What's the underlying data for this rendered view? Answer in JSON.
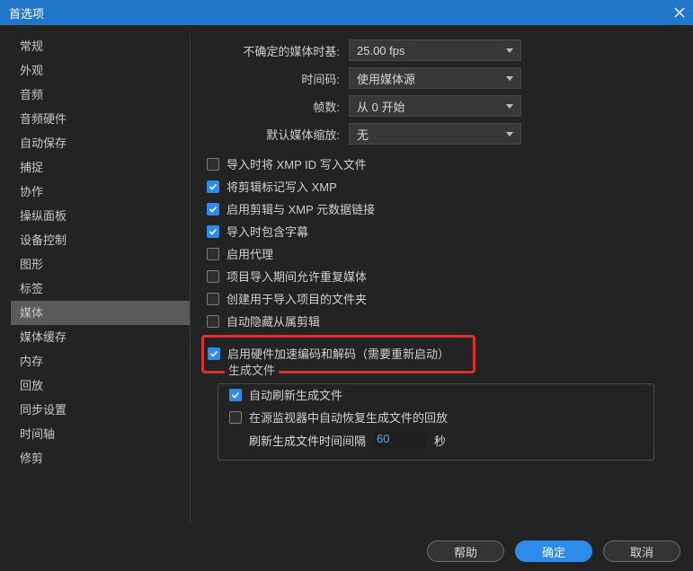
{
  "title": "首选项",
  "sidebar": {
    "items": [
      {
        "label": "常规"
      },
      {
        "label": "外观"
      },
      {
        "label": "音频"
      },
      {
        "label": "音频硬件"
      },
      {
        "label": "自动保存"
      },
      {
        "label": "捕捉"
      },
      {
        "label": "协作"
      },
      {
        "label": "操纵面板"
      },
      {
        "label": "设备控制"
      },
      {
        "label": "图形"
      },
      {
        "label": "标签"
      },
      {
        "label": "媒体"
      },
      {
        "label": "媒体缓存"
      },
      {
        "label": "内存"
      },
      {
        "label": "回放"
      },
      {
        "label": "同步设置"
      },
      {
        "label": "时间轴"
      },
      {
        "label": "修剪"
      }
    ]
  },
  "form": {
    "indeterminate_timebase_label": "不确定的媒体时基:",
    "indeterminate_timebase_value": "25.00 fps",
    "timecode_label": "时间码:",
    "timecode_value": "使用媒体源",
    "frames_label": "帧数:",
    "frames_value": "从 0 开始",
    "default_scale_label": "默认媒体缩放:",
    "default_scale_value": "无"
  },
  "checks": [
    {
      "label": "导入时将 XMP ID 写入文件",
      "checked": false
    },
    {
      "label": "将剪辑标记写入 XMP",
      "checked": true
    },
    {
      "label": "启用剪辑与 XMP 元数据链接",
      "checked": true
    },
    {
      "label": "导入时包含字幕",
      "checked": true
    },
    {
      "label": "启用代理",
      "checked": false
    },
    {
      "label": "项目导入期间允许重复媒体",
      "checked": false
    },
    {
      "label": "创建用于导入项目的文件夹",
      "checked": false
    },
    {
      "label": "自动隐藏从属剪辑",
      "checked": false
    }
  ],
  "highlight": {
    "label": "启用硬件加速编码和解码（需要重新启动）",
    "checked": true
  },
  "group": {
    "title": "生成文件",
    "auto_refresh": {
      "label": "自动刷新生成文件",
      "checked": true
    },
    "restore_playback": {
      "label": "在源监视器中自动恢复生成文件的回放",
      "checked": false
    },
    "refresh_interval_label_pre": "刷新生成文件时间间隔",
    "refresh_interval_value": "60",
    "refresh_interval_label_post": "秒"
  },
  "buttons": {
    "help": "帮助",
    "ok": "确定",
    "cancel": "取消"
  }
}
